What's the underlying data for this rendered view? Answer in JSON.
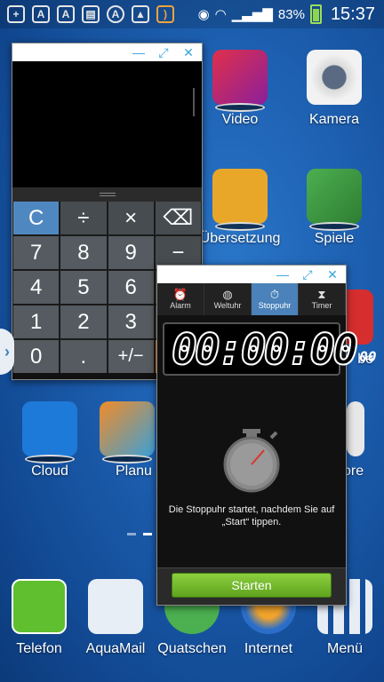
{
  "status_bar": {
    "left_icons": [
      "plus-icon",
      "aquamail-icon",
      "aquamail-icon",
      "sim-icon",
      "aquamail-icon",
      "image-icon",
      "rss-icon"
    ],
    "battery_percent": "83%",
    "time": "15:37"
  },
  "home_apps": [
    {
      "label": "Video",
      "icon": "video-icon"
    },
    {
      "label": "Kamera",
      "icon": "camera-icon"
    },
    {
      "label": "Übersetzung",
      "icon": "dict-icon"
    },
    {
      "label": "Spiele",
      "icon": "games-icon"
    },
    {
      "label": "be",
      "icon": "youtube-icon"
    },
    {
      "label": "Cloud",
      "icon": "dropbox-icon"
    },
    {
      "label": "Planu",
      "icon": "planner-icon"
    },
    {
      "label": "ore",
      "icon": "store-icon"
    }
  ],
  "dock": [
    {
      "label": "Telefon",
      "icon": "phone-icon"
    },
    {
      "label": "AquaMail",
      "icon": "aquamail-icon"
    },
    {
      "label": "Quatschen",
      "icon": "chat-icon"
    },
    {
      "label": "Internet",
      "icon": "globe-icon"
    },
    {
      "label": "Menü",
      "icon": "apps-grid-icon"
    }
  ],
  "calculator": {
    "keys": [
      "C",
      "÷",
      "×",
      "⌫",
      "7",
      "8",
      "9",
      "−",
      "4",
      "5",
      "6",
      "",
      "1",
      "2",
      "3",
      "",
      "0",
      ".",
      "+/−",
      ""
    ]
  },
  "stopwatch": {
    "tabs": [
      "Alarm",
      "Weltuhr",
      "Stoppuhr",
      "Timer"
    ],
    "active_tab": "Stoppuhr",
    "time": "00:00:00",
    "hundredths": "00",
    "hint": "Die Stoppuhr startet, nachdem Sie auf „Start“ tippen.",
    "start_button": "Starten"
  },
  "colors": {
    "accent": "#3aa7d8",
    "start_green": "#6db12a",
    "tab_active": "#4a82b9"
  }
}
